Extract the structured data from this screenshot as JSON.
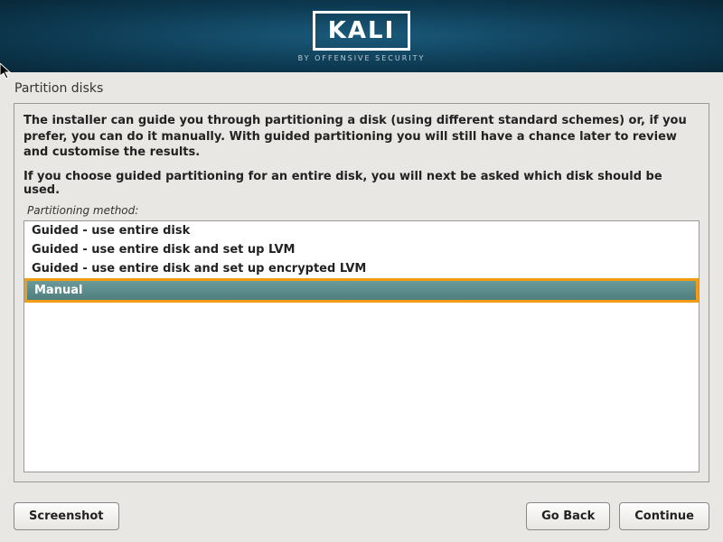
{
  "header": {
    "logo_text": "KALI",
    "logo_subtitle": "BY OFFENSIVE SECURITY"
  },
  "page": {
    "title": "Partition disks"
  },
  "content": {
    "instructions": "The installer can guide you through partitioning a disk (using different standard schemes) or, if you prefer, you can do it manually. With guided partitioning you will still have a chance later to review and customise the results.",
    "instructions2": "If you choose guided partitioning for an entire disk, you will next be asked which disk should be used.",
    "method_label": "Partitioning method:",
    "options": [
      {
        "label": "Guided - use entire disk",
        "selected": false
      },
      {
        "label": "Guided - use entire disk and set up LVM",
        "selected": false
      },
      {
        "label": "Guided - use entire disk and set up encrypted LVM",
        "selected": false
      },
      {
        "label": "Manual",
        "selected": true
      }
    ]
  },
  "buttons": {
    "screenshot": "Screenshot",
    "go_back": "Go Back",
    "continue": "Continue"
  }
}
